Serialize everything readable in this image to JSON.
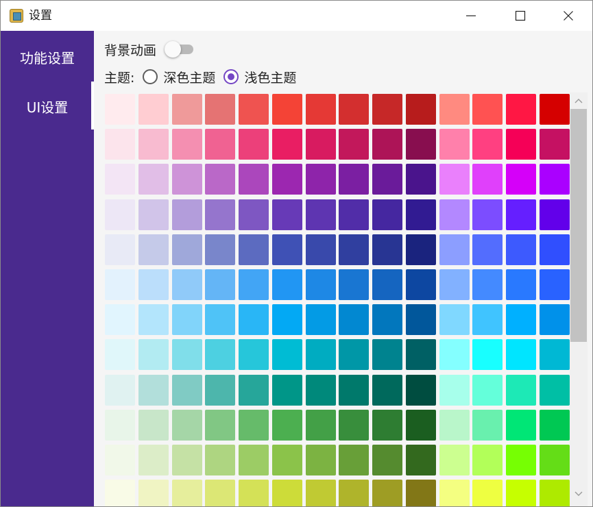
{
  "window": {
    "title": "设置",
    "icons": {
      "app": "app-icon",
      "minimize": "minimize-icon",
      "maximize": "maximize-icon",
      "close": "close-icon"
    }
  },
  "sidebar": {
    "background": "#4a2a8e",
    "items": [
      {
        "label": "功能设置",
        "selected": false
      },
      {
        "label": "UI设置",
        "selected": true
      }
    ]
  },
  "settings": {
    "background_animation": {
      "label": "背景动画",
      "enabled": false
    },
    "theme": {
      "label": "主题:",
      "options": [
        {
          "label": "深色主题",
          "selected": false
        },
        {
          "label": "浅色主题",
          "selected": true
        }
      ],
      "accent": "#7446c4"
    }
  },
  "palette": {
    "rows": [
      [
        "#ffebee",
        "#ffcdd2",
        "#ef9a9a",
        "#e57373",
        "#ef5350",
        "#f44336",
        "#e53935",
        "#d32f2f",
        "#c62828",
        "#b71c1c",
        "#ff8a80",
        "#ff5252",
        "#ff1744",
        "#d50000"
      ],
      [
        "#fce4ec",
        "#f8bbd0",
        "#f48fb1",
        "#f06292",
        "#ec407a",
        "#e91e63",
        "#d81b60",
        "#c2185b",
        "#ad1457",
        "#880e4f",
        "#ff80ab",
        "#ff4081",
        "#f50057",
        "#c51162"
      ],
      [
        "#f3e5f5",
        "#e1bee7",
        "#ce93d8",
        "#ba68c8",
        "#ab47bc",
        "#9c27b0",
        "#8e24aa",
        "#7b1fa2",
        "#6a1b9a",
        "#4a148c",
        "#ea80fc",
        "#e040fb",
        "#d500f9",
        "#aa00ff"
      ],
      [
        "#ede7f6",
        "#d1c4e9",
        "#b39ddb",
        "#9575cd",
        "#7e57c2",
        "#673ab7",
        "#5e35b1",
        "#512da8",
        "#4527a0",
        "#311b92",
        "#b388ff",
        "#7c4dff",
        "#651fff",
        "#6200ea"
      ],
      [
        "#e8eaf6",
        "#c5cae9",
        "#9fa8da",
        "#7986cb",
        "#5c6bc0",
        "#3f51b5",
        "#3949ab",
        "#303f9f",
        "#283593",
        "#1a237e",
        "#8c9eff",
        "#536dfe",
        "#3d5afe",
        "#304ffe"
      ],
      [
        "#e3f2fd",
        "#bbdefb",
        "#90caf9",
        "#64b5f6",
        "#42a5f5",
        "#2196f3",
        "#1e88e5",
        "#1976d2",
        "#1565c0",
        "#0d47a1",
        "#82b1ff",
        "#448aff",
        "#2979ff",
        "#2962ff"
      ],
      [
        "#e1f5fe",
        "#b3e5fc",
        "#81d4fa",
        "#4fc3f7",
        "#29b6f6",
        "#03a9f4",
        "#039be5",
        "#0288d1",
        "#0277bd",
        "#01579b",
        "#80d8ff",
        "#40c4ff",
        "#00b0ff",
        "#0091ea"
      ],
      [
        "#e0f7fa",
        "#b2ebf2",
        "#80deea",
        "#4dd0e1",
        "#26c6da",
        "#00bcd4",
        "#00acc1",
        "#0097a7",
        "#00838f",
        "#006064",
        "#84ffff",
        "#18ffff",
        "#00e5ff",
        "#00b8d4"
      ],
      [
        "#e0f2f1",
        "#b2dfdb",
        "#80cbc4",
        "#4db6ac",
        "#26a69a",
        "#009688",
        "#00897b",
        "#00796b",
        "#00695c",
        "#004d40",
        "#a7ffeb",
        "#64ffda",
        "#1de9b6",
        "#00bfa5"
      ],
      [
        "#e8f5e9",
        "#c8e6c9",
        "#a5d6a7",
        "#81c784",
        "#66bb6a",
        "#4caf50",
        "#43a047",
        "#388e3c",
        "#2e7d32",
        "#1b5e20",
        "#b9f6ca",
        "#69f0ae",
        "#00e676",
        "#00c853"
      ],
      [
        "#f1f8e9",
        "#dcedc8",
        "#c5e1a5",
        "#aed581",
        "#9ccc65",
        "#8bc34a",
        "#7cb342",
        "#689f38",
        "#558b2f",
        "#33691e",
        "#ccff90",
        "#b2ff59",
        "#76ff03",
        "#64dd17"
      ],
      [
        "#f9fbe7",
        "#f0f4c3",
        "#e6ee9c",
        "#dce775",
        "#d4e157",
        "#cddc39",
        "#c0ca33",
        "#afb42b",
        "#9e9d24",
        "#827717",
        "#f4ff81",
        "#eeff41",
        "#c6ff00",
        "#aeea00"
      ]
    ]
  },
  "scrollbar": {
    "up_icon": "scroll-up-arrow-icon",
    "down_icon": "scroll-down-arrow-icon"
  }
}
